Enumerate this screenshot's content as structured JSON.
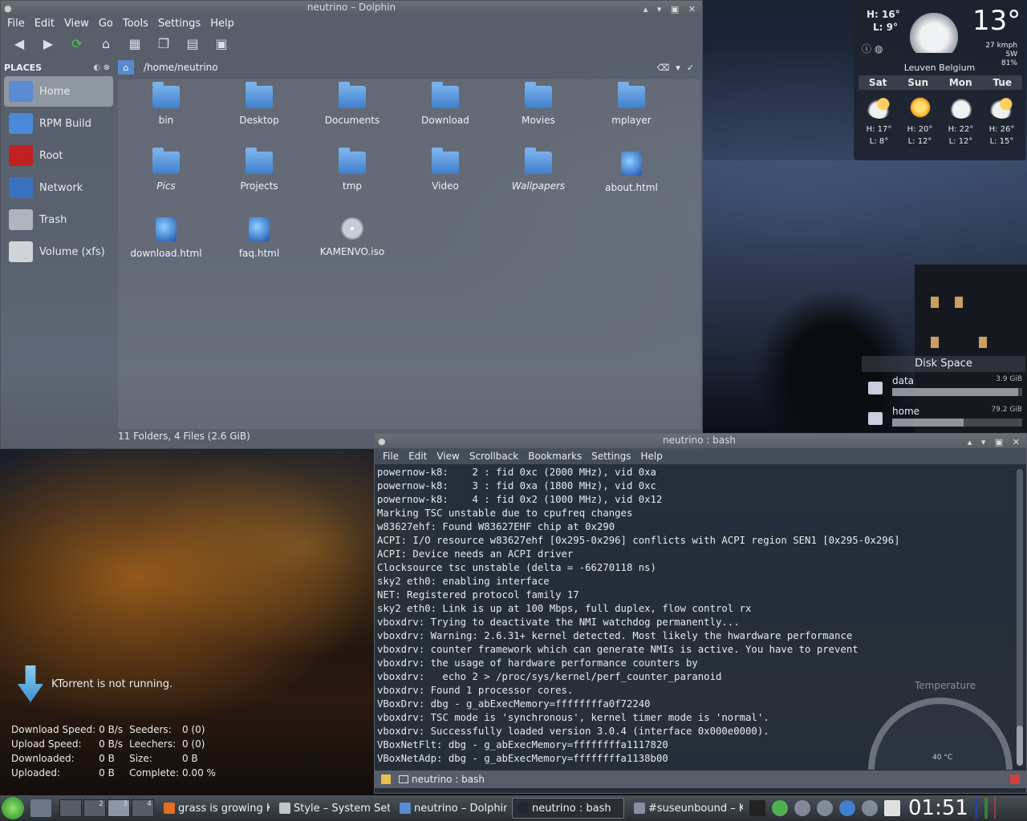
{
  "dolphin": {
    "title": "neutrino – Dolphin",
    "menu": [
      "File",
      "Edit",
      "View",
      "Go",
      "Tools",
      "Settings",
      "Help"
    ],
    "places_header": "PLACES",
    "places": [
      {
        "label": "Home",
        "icon": "home-icon",
        "color": "#5a8ad0"
      },
      {
        "label": "RPM Build",
        "icon": "folder-icon",
        "color": "#4a8ad8"
      },
      {
        "label": "Root",
        "icon": "folder-red-icon",
        "color": "#c02020"
      },
      {
        "label": "Network",
        "icon": "globe-icon",
        "color": "#3a70c0"
      },
      {
        "label": "Trash",
        "icon": "trash-icon",
        "color": "#b0b4bc"
      },
      {
        "label": "Volume (xfs)",
        "icon": "drive-icon",
        "color": "#d0d4da"
      }
    ],
    "path": "/home/neutrino",
    "files": [
      {
        "label": "bin",
        "type": "folder"
      },
      {
        "label": "Desktop",
        "type": "desktop"
      },
      {
        "label": "Documents",
        "type": "folder"
      },
      {
        "label": "Download",
        "type": "folder"
      },
      {
        "label": "Movies",
        "type": "folder"
      },
      {
        "label": "mplayer",
        "type": "folder"
      },
      {
        "label": "Pics",
        "type": "folder-link"
      },
      {
        "label": "Projects",
        "type": "folder"
      },
      {
        "label": "tmp",
        "type": "folder"
      },
      {
        "label": "Video",
        "type": "folder"
      },
      {
        "label": "Wallpapers",
        "type": "folder-link"
      },
      {
        "label": "about.html",
        "type": "html"
      },
      {
        "label": "download.html",
        "type": "html"
      },
      {
        "label": "faq.html",
        "type": "html"
      },
      {
        "label": "KAMENVO.iso",
        "type": "iso"
      }
    ],
    "status": "11 Folders, 4 Files (2.6 GiB)"
  },
  "weather": {
    "high": "H: 16°",
    "low": "L: 9°",
    "temp": "13°",
    "wind": "27 kmph SW",
    "humidity": "81%",
    "location": "Leuven Belgium",
    "days": [
      {
        "day": "Sat",
        "high": "H: 17°",
        "low": "L: 8°",
        "icon": "cloudsun"
      },
      {
        "day": "Sun",
        "high": "H: 20°",
        "low": "L: 12°",
        "icon": "sun"
      },
      {
        "day": "Mon",
        "high": "H: 22°",
        "low": "L: 12°",
        "icon": "cloudy"
      },
      {
        "day": "Tue",
        "high": "H: 26°",
        "low": "L: 15°",
        "icon": "cloudsun"
      }
    ]
  },
  "disk": {
    "title": "Disk Space",
    "items": [
      {
        "name": "data",
        "size": "3.9 GiB",
        "used_fraction": 0.97
      },
      {
        "name": "home",
        "size": "79.2 GiB",
        "used_fraction": 0.55
      }
    ]
  },
  "ktorrent": {
    "message": "KTorrent is not running.",
    "download_speed_label": "Download Speed:",
    "download_speed": "0 B/s",
    "seeders_label": "Seeders:",
    "seeders": "0 (0)",
    "upload_speed_label": "Upload Speed:",
    "upload_speed": "0 B/s",
    "leechers_label": "Leechers:",
    "leechers": "0 (0)",
    "downloaded_label": "Downloaded:",
    "downloaded": "0 B",
    "size_label": "Size:",
    "size": "0 B",
    "uploaded_label": "Uploaded:",
    "uploaded": "0 B",
    "complete_label": "Complete:",
    "complete": "0.00 %"
  },
  "konsole": {
    "title": "neutrino : bash",
    "menu": [
      "File",
      "Edit",
      "View",
      "Scrollback",
      "Bookmarks",
      "Settings",
      "Help"
    ],
    "lines": [
      "powernow-k8:    2 : fid 0xc (2000 MHz), vid 0xa",
      "powernow-k8:    3 : fid 0xa (1800 MHz), vid 0xc",
      "powernow-k8:    4 : fid 0x2 (1000 MHz), vid 0x12",
      "Marking TSC unstable due to cpufreq changes",
      "w83627ehf: Found W83627EHF chip at 0x290",
      "ACPI: I/O resource w83627ehf [0x295-0x296] conflicts with ACPI region SEN1 [0x295-0x296]",
      "ACPI: Device needs an ACPI driver",
      "Clocksource tsc unstable (delta = -66270118 ns)",
      "sky2 eth0: enabling interface",
      "NET: Registered protocol family 17",
      "sky2 eth0: Link is up at 100 Mbps, full duplex, flow control rx",
      "vboxdrv: Trying to deactivate the NMI watchdog permanently...",
      "vboxdrv: Warning: 2.6.31+ kernel detected. Most likely the hwardware performance",
      "vboxdrv: counter framework which can generate NMIs is active. You have to prevent",
      "vboxdrv: the usage of hardware performance counters by",
      "vboxdrv:   echo 2 > /proc/sys/kernel/perf_counter_paranoid",
      "vboxdrv: Found 1 processor cores.",
      "VBoxDrv: dbg - g_abExecMemory=ffffffffa0f72240",
      "vboxdrv: TSC mode is 'synchronous', kernel timer mode is 'normal'.",
      "vboxdrv: Successfully loaded version 3.0.4 (interface 0x000e0000).",
      "VBoxNetFlt: dbg - g_abExecMemory=ffffffffa1117820",
      "VBoxNetAdp: dbg - g_abExecMemory=ffffffffa1138b00"
    ],
    "tab_label": "neutrino : bash"
  },
  "temperature": {
    "label": "Temperature",
    "value": "40 °C"
  },
  "taskbar": {
    "pager": [
      "2",
      "3",
      "4"
    ],
    "tasks": [
      {
        "label": "grass is growing KD",
        "color": "#e07020"
      },
      {
        "label": "Style – System Set",
        "color": "#c0c4cc"
      },
      {
        "label": "neutrino – Dolphin",
        "color": "#5a8ad0"
      },
      {
        "label": "neutrino : bash",
        "color": "#222831"
      },
      {
        "label": "#suseunbound – Ko",
        "color": "#8a8ea0"
      }
    ],
    "clock": "01:51"
  }
}
